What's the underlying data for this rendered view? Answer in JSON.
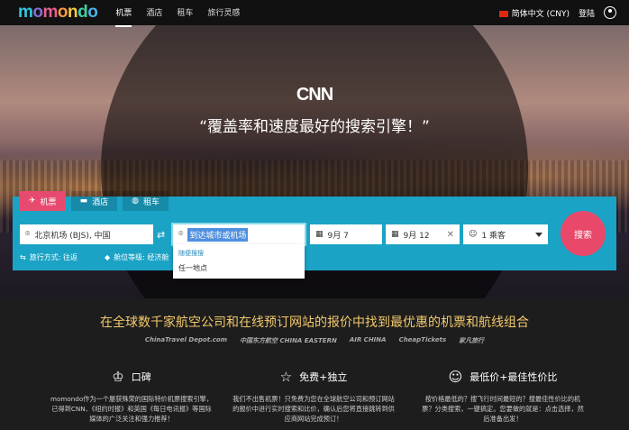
{
  "nav": {
    "brand": "momondo",
    "brand_colors": [
      "#31c8e0",
      "#8a6bd6",
      "#e85f8e",
      "#f59b44",
      "#f7c948",
      "#3fd1a3",
      "#4fb0e8"
    ],
    "links": [
      "机票",
      "酒店",
      "租车",
      "旅行灵感"
    ],
    "active_link": "机票",
    "language": "简体中文 (CNY)",
    "login": "登陆"
  },
  "hero": {
    "source_logo": "CNN",
    "quote": "“覆盖率和速度最好的搜索引擎！”"
  },
  "search": {
    "tabs": [
      {
        "label": "机票",
        "icon": "plane-icon"
      },
      {
        "label": "酒店",
        "icon": "bed-icon"
      },
      {
        "label": "租车",
        "icon": "car-icon"
      }
    ],
    "from_value": "北京机场 (BJS), 中国",
    "to_value": "到达城市或机场",
    "depart_date": "9月 7",
    "return_date": "9月 12",
    "passengers": "1 乘客",
    "trip_type": "旅行方式: 往返",
    "cabin_class": "舱位等级: 经济舱",
    "search_button": "搜索",
    "dropdown_header": "随便搜搜",
    "dropdown_item": "任一地点",
    "accent": "#1ba3c6",
    "button_color": "#e8486a"
  },
  "lower": {
    "tagline": "在全球数千家航空公司和在线预订网站的报价中找到最优惠的机票和航线组合",
    "partners": [
      "ChinaTravel Depot.com",
      "中国东方航空 CHINA EASTERN",
      "AIR CHINA",
      "CheapTickets",
      "家凡旅行"
    ],
    "features": [
      {
        "title": "口碑",
        "icon": "award-icon",
        "desc": "momondo作为一个屡获殊荣的国际特价机票搜索引擎，已得到CNN、《纽约时报》和英国《每日电讯报》等国际媒体的广泛关注和强力推荐！"
      },
      {
        "title": "免费+独立",
        "icon": "star-icon",
        "desc": "我们不出售机票！只免费为您在全球航空公司和预订网站的报价中进行实时搜索和比价，确认后您将直接跳转到供应商网站完成预订！"
      },
      {
        "title": "最低价+最佳性价比",
        "icon": "smile-icon",
        "desc": "按价格最低的？搜飞行时间最短的？搜最佳性价比的机票？分类搜索，一键搞定。您要做的就是：点击选择，然后准备出发！"
      }
    ]
  }
}
